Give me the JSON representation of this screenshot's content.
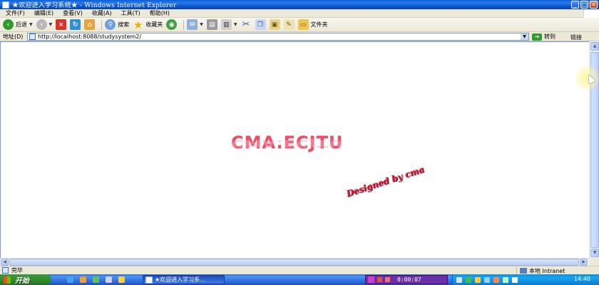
{
  "window": {
    "title": "★欢迎进入学习系统★ - Windows Internet Explorer",
    "controls": [
      "minimize",
      "maximize",
      "close"
    ]
  },
  "menu": [
    "文件(F)",
    "编辑(E)",
    "查看(V)",
    "收藏(A)",
    "工具(T)",
    "帮助(H)"
  ],
  "toolbar": {
    "back_label": "后退",
    "search_label": "搜索",
    "favorites_label": "收藏夹",
    "folders_label": "文件夹"
  },
  "address": {
    "label": "地址(D)",
    "url": "http://localhost:8088/studysystem2/",
    "go_label": "转到",
    "links_label": "链接"
  },
  "content": {
    "logo_text": "CMA.ECJTU",
    "signature_text": "Designed by cma"
  },
  "status": {
    "text": "完毕",
    "zone": "本地 Intranet"
  },
  "taskbar": {
    "start_label": "开始",
    "task_label": "★欢迎进入学习系...",
    "media_time": "0:00:07",
    "clock": "14:40"
  },
  "colors": {
    "titlebar": "#0a5fd8",
    "logo": "#e8506a",
    "signature": "#d6213f",
    "taskbar": "#3168d5",
    "start": "#3c9a3c"
  }
}
